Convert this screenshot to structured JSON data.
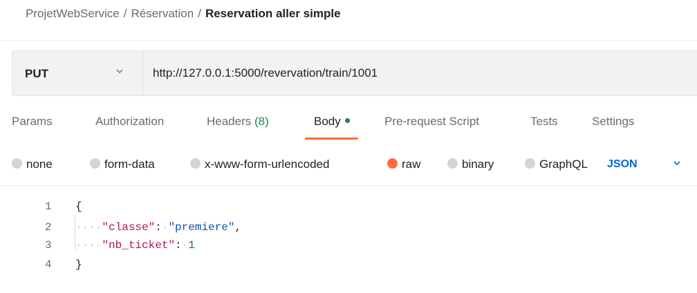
{
  "breadcrumb": {
    "collection": "ProjetWebService",
    "folder": "Réservation",
    "request": "Reservation aller simple",
    "separator": "/"
  },
  "request": {
    "method": "PUT",
    "url": "http://127.0.0.1:5000/revervation/train/1001"
  },
  "tabs": {
    "params": "Params",
    "authorization": "Authorization",
    "headers": "Headers",
    "headers_count": "(8)",
    "body": "Body",
    "prerequest": "Pre-request Script",
    "tests": "Tests",
    "settings": "Settings",
    "active": "Body"
  },
  "body_types": {
    "none": "none",
    "form_data": "form-data",
    "urlencoded": "x-www-form-urlencoded",
    "raw": "raw",
    "binary": "binary",
    "graphql": "GraphQL",
    "selected": "raw",
    "format": "JSON"
  },
  "editor": {
    "line_numbers": [
      "1",
      "2",
      "3",
      "4"
    ],
    "open_brace": "{",
    "close_brace": "}",
    "indent": "····",
    "key1": "\"classe\"",
    "value1": "\"premiere\"",
    "key2": "\"nb_ticket\"",
    "value2": "1"
  },
  "colors": {
    "accent_orange": "#ff6c37",
    "green": "#1e8a4c",
    "link_blue": "#0265d2"
  }
}
